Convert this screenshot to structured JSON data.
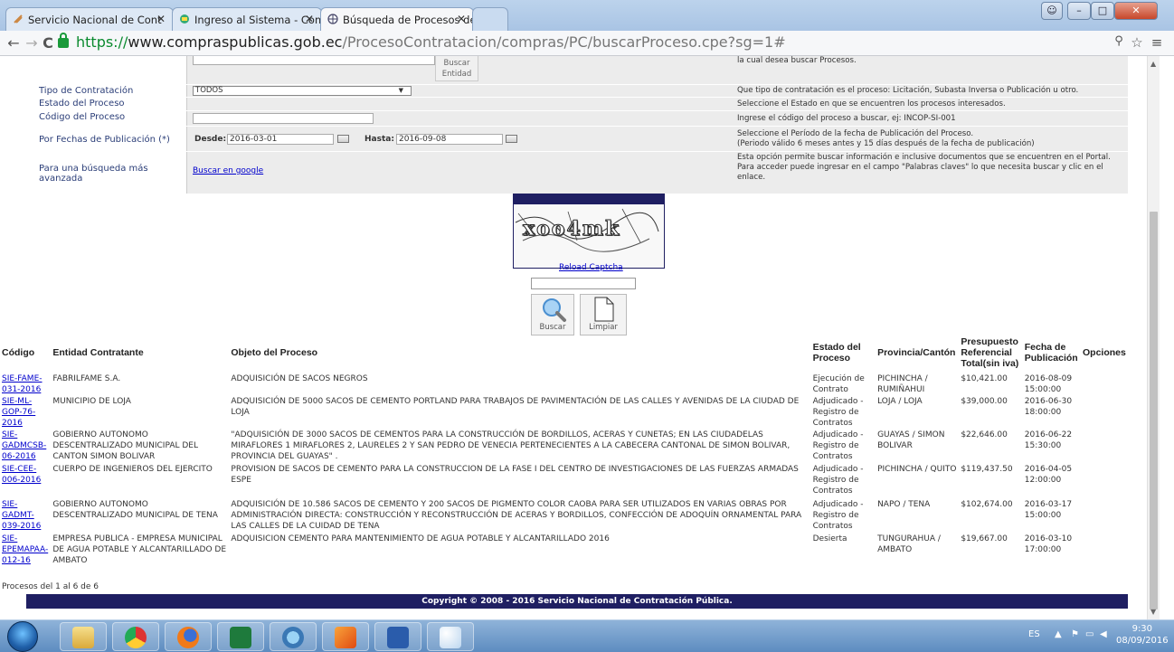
{
  "browser": {
    "tabs": [
      {
        "title": "Servicio Nacional de Cont"
      },
      {
        "title": "Ingreso al Sistema - Comp"
      },
      {
        "title": "Búsqueda de Procesos de"
      }
    ],
    "url_scheme": "https://",
    "url_host": "www.compraspublicas.gob.ec",
    "url_path": "/ProcesoContratacion/compras/PC/buscarProceso.cpe?sg=1#"
  },
  "form": {
    "buscar_entidad": "Buscar Entidad",
    "entidad_help": "la cual desea buscar Procesos.",
    "rows": [
      {
        "label": "Tipo de Contratación",
        "help": "Que tipo de contratación es el proceso: Licitación, Subasta Inversa o Publicación u otro."
      },
      {
        "label": "Estado del Proceso",
        "help": "Seleccione el Estado en que se encuentren los procesos interesados."
      },
      {
        "label": "Código del Proceso",
        "help": "Ingrese el código del proceso a buscar, ej: INCOP-SI-001"
      },
      {
        "label": "Por Fechas de Publicación (*)",
        "help": "Seleccione el Período de la fecha de Publicación del Proceso.",
        "help2": "(Periodo válido 6 meses antes y 15 días después de la fecha de publicación)"
      },
      {
        "label": "Para una búsqueda más avanzada",
        "help": "Esta opción permite buscar información e inclusive documentos que se encuentren en el Portal. Para acceder puede ingresar en el campo \"Palabras claves\" lo que necesita buscar y clic en el enlace."
      }
    ],
    "tipo_value": "TODOS",
    "desde_label": "Desde:",
    "desde_value": "2016-03-01",
    "hasta_label": "Hasta:",
    "hasta_value": "2016-09-08",
    "google_link": "Buscar en google"
  },
  "captcha": {
    "text": "xoo4mk",
    "reload": "Reload Captcha",
    "buscar": "Buscar",
    "limpiar": "Limpiar"
  },
  "table": {
    "headers": [
      "Código",
      "Entidad Contratante",
      "Objeto del Proceso",
      "Estado del Proceso",
      "Provincia/Cantón",
      "Presupuesto Referencial Total(sin iva)",
      "Fecha de Publicación",
      "Opciones"
    ],
    "rows": [
      {
        "codigo": "SIE-FAME-031-2016",
        "entidad": "FABRILFAME S.A.",
        "objeto": "ADQUISICIÓN DE SACOS NEGROS",
        "estado": "Ejecución de Contrato",
        "provincia": "PICHINCHA / RUMIÑAHUI",
        "presupuesto": "$10,421.00",
        "fecha": "2016-08-09 15:00:00"
      },
      {
        "codigo": "SIE-ML-GOP-76-2016",
        "entidad": "MUNICIPIO DE LOJA",
        "objeto": "ADQUISICIÓN DE 5000 SACOS DE CEMENTO PORTLAND PARA TRABAJOS DE PAVIMENTACIÓN DE LAS CALLES Y AVENIDAS DE LA CIUDAD DE LOJA",
        "estado": "Adjudicado - Registro de Contratos",
        "provincia": "LOJA / LOJA",
        "presupuesto": "$39,000.00",
        "fecha": "2016-06-30 18:00:00"
      },
      {
        "codigo": "SIE-GADMCSB-06-2016",
        "entidad": "GOBIERNO AUTONOMO DESCENTRALIZADO MUNICIPAL DEL CANTON SIMON BOLIVAR",
        "objeto": "\"ADQUISICIÓN DE 3000 SACOS DE CEMENTOS PARA LA CONSTRUCCIÓN DE BORDILLOS, ACERAS Y CUNETAS; EN LAS CIUDADELAS MIRAFLORES 1 MIRAFLORES 2, LAURELES 2 Y SAN PEDRO DE VENECIA PERTENECIENTES A LA CABECERA CANTONAL DE SIMON BOLIVAR, PROVINCIA DEL GUAYAS\" .",
        "estado": "Adjudicado - Registro de Contratos",
        "provincia": "GUAYAS / SIMON BOLIVAR",
        "presupuesto": "$22,646.00",
        "fecha": "2016-06-22 15:30:00"
      },
      {
        "codigo": "SIE-CEE-006-2016",
        "entidad": "CUERPO DE INGENIEROS DEL EJERCITO",
        "objeto": "PROVISION DE SACOS DE CEMENTO PARA LA CONSTRUCCION DE LA FASE I DEL CENTRO DE INVESTIGACIONES DE LAS FUERZAS ARMADAS ESPE",
        "estado": "Adjudicado - Registro de Contratos",
        "provincia": "PICHINCHA / QUITO",
        "presupuesto": "$119,437.50",
        "fecha": "2016-04-05 12:00:00"
      },
      {
        "codigo": "SIE-GADMT-039-2016",
        "entidad": "GOBIERNO AUTONOMO DESCENTRALIZADO MUNICIPAL DE TENA",
        "objeto": "ADQUISICIÓN DE 10.586 SACOS DE CEMENTO Y 200 SACOS DE PIGMENTO COLOR CAOBA PARA SER UTILIZADOS EN VARIAS OBRAS POR ADMINISTRACIÓN DIRECTA: CONSTRUCCIÓN Y RECONSTRUCCIÓN DE ACERAS Y BORDILLOS, CONFECCIÓN DE ADOQUÍN ORNAMENTAL PARA LAS CALLES DE LA CUIDAD DE TENA",
        "estado": "Adjudicado - Registro de Contratos",
        "provincia": "NAPO / TENA",
        "presupuesto": "$102,674.00",
        "fecha": "2016-03-17 15:00:00"
      },
      {
        "codigo": "SIE-EPEMAPAA-012-16",
        "entidad": "EMPRESA PUBLICA - EMPRESA MUNICIPAL DE AGUA POTABLE Y ALCANTARILLADO DE AMBATO",
        "objeto": "ADQUISICION CEMENTO PARA MANTENIMIENTO DE AGUA POTABLE Y ALCANTARILLADO 2016",
        "estado": "Desierta",
        "provincia": "TUNGURAHUA / AMBATO",
        "presupuesto": "$19,667.00",
        "fecha": "2016-03-10 17:00:00"
      }
    ]
  },
  "procesos_text": "Procesos del 1 al 6 de 6",
  "footer": "Copyright © 2008 - 2016 Servicio Nacional de Contratación Pública.",
  "taskbar": {
    "lang": "ES",
    "time": "9:30",
    "date": "08/09/2016"
  }
}
